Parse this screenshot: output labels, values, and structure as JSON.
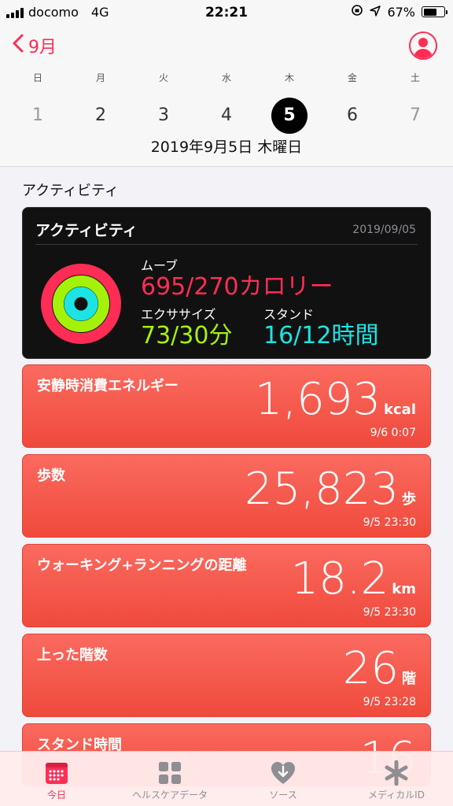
{
  "status": {
    "carrier": "docomo",
    "network": "4G",
    "time": "22:21",
    "battery": "67%",
    "battery_level": 0.67
  },
  "header": {
    "back_label": "9月",
    "weekdays": [
      "日",
      "月",
      "火",
      "水",
      "木",
      "金",
      "土"
    ],
    "days": [
      "1",
      "2",
      "3",
      "4",
      "5",
      "6",
      "7"
    ],
    "selected_day": "5",
    "date_label": "2019年9月5日 木曜日"
  },
  "section_title": "アクティビティ",
  "activity": {
    "title": "アクティビティ",
    "date": "2019/09/05",
    "move_label": "ムーブ",
    "move_value": "695/270カロリー",
    "exercise_label": "エクササイズ",
    "exercise_value": "73/30分",
    "stand_label": "スタンド",
    "stand_value": "16/12時間",
    "colors": {
      "move": "#ff2d55",
      "exercise": "#a4f20a",
      "stand": "#1ce4e4"
    }
  },
  "cards": [
    {
      "label": "安静時消費エネルギー",
      "value": "1,693",
      "unit": "kcal",
      "time": "9/6 0:07"
    },
    {
      "label": "歩数",
      "value": "25,823",
      "unit": "歩",
      "time": "9/5 23:30"
    },
    {
      "label": "ウォーキング+ランニングの距離",
      "value": "18.2",
      "unit": "km",
      "time": "9/5 23:30"
    },
    {
      "label": "上った階数",
      "value": "26",
      "unit": "階",
      "time": "9/5 23:28"
    },
    {
      "label": "スタンド時間",
      "value": "16"
    }
  ],
  "tabs": [
    {
      "label": "今日",
      "icon": "calendar-icon"
    },
    {
      "label": "ヘルスケアデータ",
      "icon": "grid-icon"
    },
    {
      "label": "ソース",
      "icon": "heart-download-icon"
    },
    {
      "label": "メディカルID",
      "icon": "asterisk-icon"
    }
  ],
  "accent_color": "#ff2d55"
}
